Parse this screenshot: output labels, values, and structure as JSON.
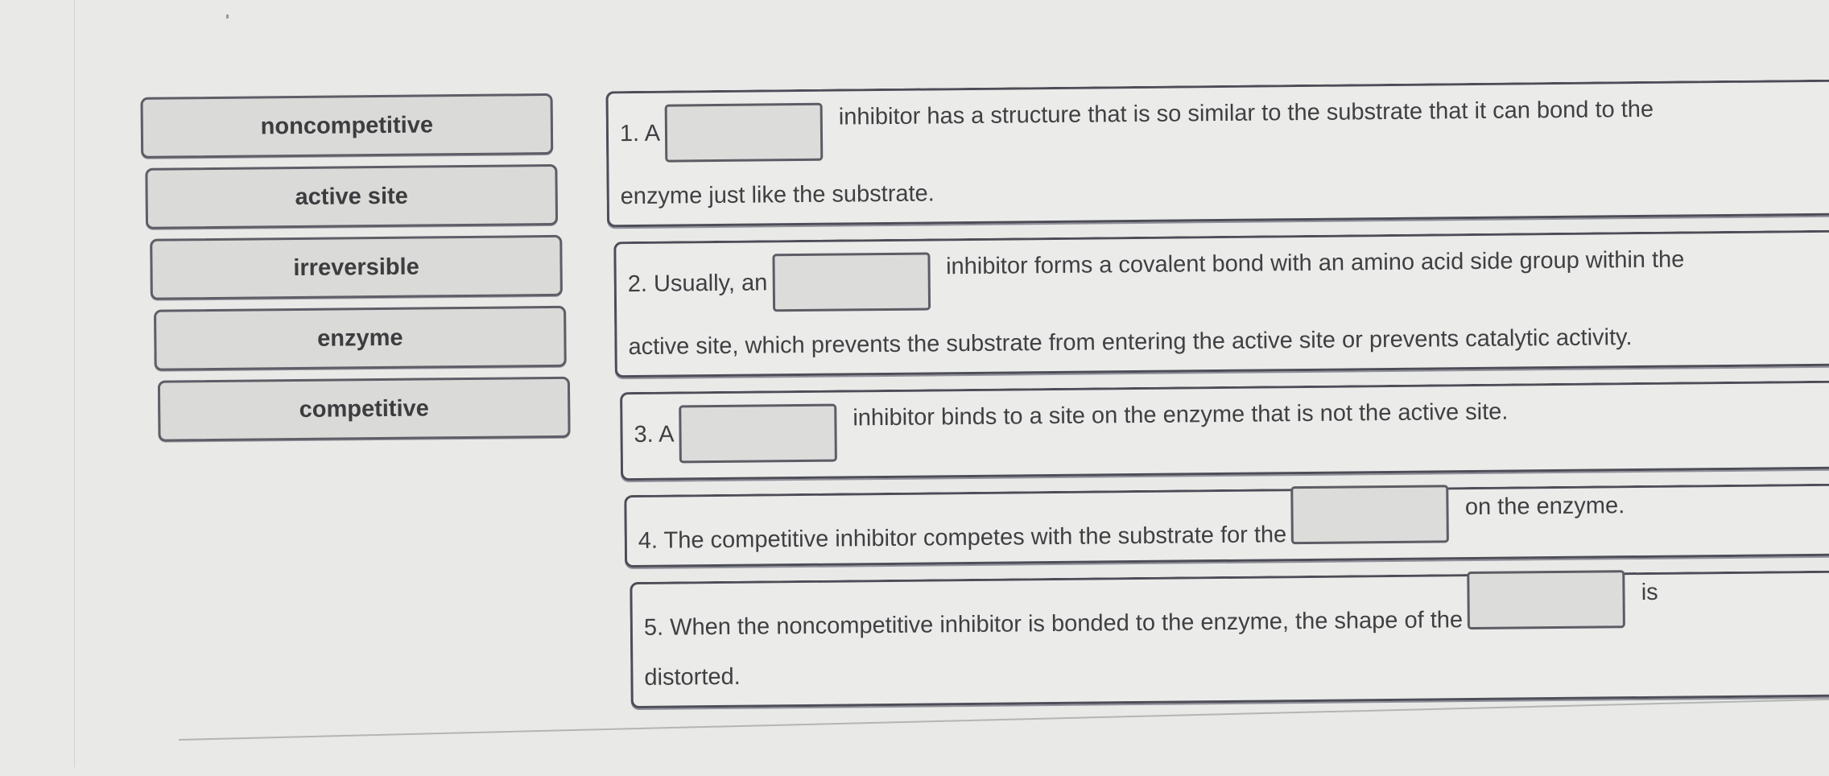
{
  "word_bank": {
    "items": [
      {
        "label": "noncompetitive"
      },
      {
        "label": "active site"
      },
      {
        "label": "irreversible"
      },
      {
        "label": "enzyme"
      },
      {
        "label": "competitive"
      }
    ]
  },
  "questions": [
    {
      "before": "1. A",
      "after": "inhibitor has a structure that is so similar to the substrate that it can bond to the",
      "continuation": "enzyme just like the substrate.",
      "answer": ""
    },
    {
      "before": "2. Usually, an",
      "after": "inhibitor forms a covalent bond with an amino acid side group within the",
      "continuation": "active site, which prevents the substrate from entering the active site or prevents catalytic activity.",
      "answer": ""
    },
    {
      "before": "3. A",
      "after": "inhibitor binds to a site on the enzyme that is not the active site.",
      "continuation": "",
      "answer": ""
    },
    {
      "before": "4. The competitive inhibitor competes with the substrate for the",
      "after": "on the enzyme.",
      "continuation": "",
      "answer": ""
    },
    {
      "before": "5. When the noncompetitive inhibitor is bonded to the enzyme, the shape of the",
      "after": "is",
      "continuation": "distorted.",
      "answer": ""
    }
  ]
}
